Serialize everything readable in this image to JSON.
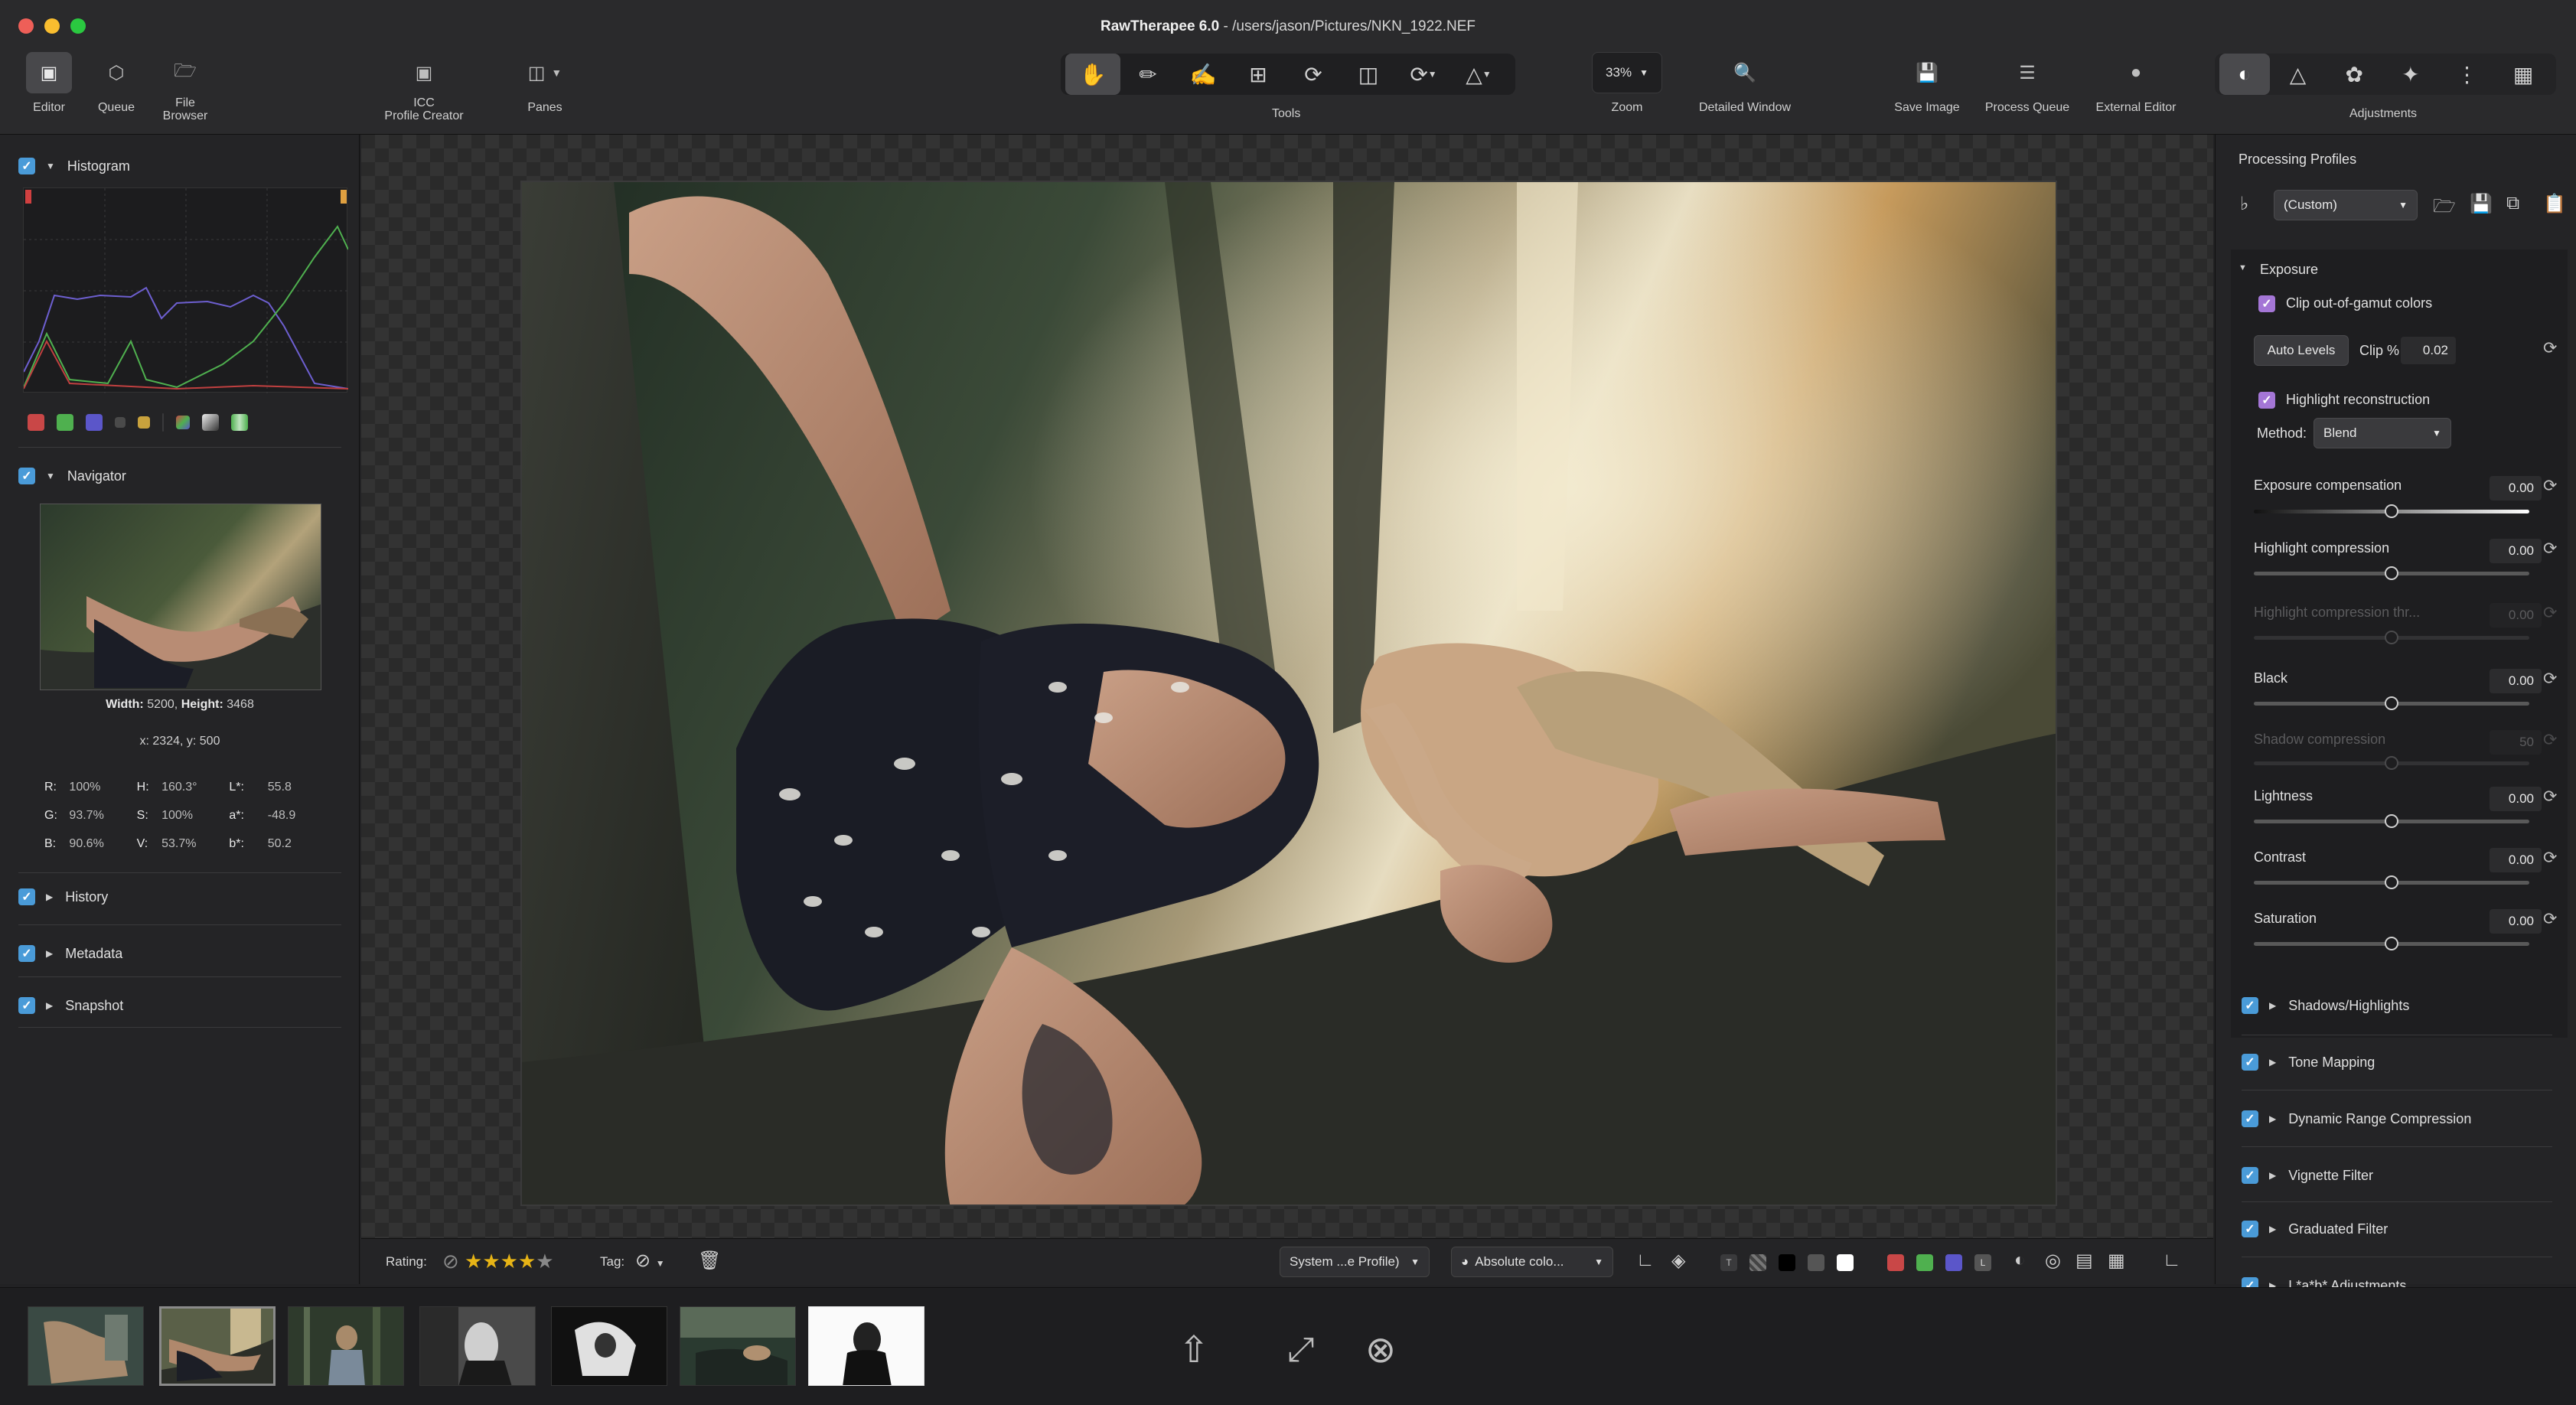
{
  "window": {
    "app_name": "RawTherapee 6.0",
    "separator": " - ",
    "file_path": "/users/jason/Pictures/NKN_1922.NEF"
  },
  "toolbar": {
    "editor": "Editor",
    "queue": "Queue",
    "file_browser_1": "File",
    "file_browser_2": "Browser",
    "icc_1": "ICC",
    "icc_2": "Profile Creator",
    "panes": "Panes",
    "tools": "Tools",
    "zoom_value": "33%",
    "zoom": "Zoom",
    "detailed_window": "Detailed Window",
    "save_image": "Save Image",
    "process_queue": "Process Queue",
    "external_editor": "External Editor",
    "adjustments": "Adjustments"
  },
  "left": {
    "histogram": "Histogram",
    "navigator": "Navigator",
    "size_width_label": "Width:",
    "size_width": "5200",
    "size_height_label": "Height:",
    "size_height": "3468",
    "coords": "x: 2324, y: 500",
    "values": [
      {
        "k1": "R:",
        "v1": "100%",
        "k2": "H:",
        "v2": "160.3°",
        "k3": "L*:",
        "v3": "55.8"
      },
      {
        "k1": "G:",
        "v1": "93.7%",
        "k2": "S:",
        "v2": "100%",
        "k3": "a*:",
        "v3": "-48.9"
      },
      {
        "k1": "B:",
        "v1": "90.6%",
        "k2": "V:",
        "v2": "53.7%",
        "k3": "b*:",
        "v3": "50.2"
      }
    ],
    "history": "History",
    "metadata": "Metadata",
    "snapshot": "Snapshot"
  },
  "bottombar": {
    "rating_label": "Rating:",
    "rating_value": 4,
    "rating_max": 5,
    "tag_label": "Tag:",
    "profile_combo": "System ...e Profile)",
    "intent_combo": "Absolute colo..."
  },
  "right": {
    "processing_profiles": "Processing Profiles",
    "profile_value": "(Custom)",
    "exposure": "Exposure",
    "clip_gamut": "Clip out-of-gamut colors",
    "auto_levels": "Auto Levels",
    "clip_label": "Clip %",
    "clip_value": "0.02",
    "highlight_recon": "Highlight reconstruction",
    "method_label": "Method:",
    "method_value": "Blend",
    "sliders": [
      {
        "label": "Exposure compensation",
        "value": "0.00"
      },
      {
        "label": "Highlight compression",
        "value": "0.00"
      },
      {
        "label": "Highlight compression thr...",
        "value": "0.00"
      },
      {
        "label": "Black",
        "value": "0.00"
      },
      {
        "label": "Shadow compression",
        "value": "50"
      },
      {
        "label": "Lightness",
        "value": "0.00"
      },
      {
        "label": "Contrast",
        "value": "0.00"
      },
      {
        "label": "Saturation",
        "value": "0.00"
      }
    ],
    "sections": [
      "Shadows/Highlights",
      "Tone Mapping",
      "Dynamic Range Compression",
      "Vignette Filter",
      "Graduated Filter",
      "L*a*b* Adjustments"
    ]
  },
  "colors": {
    "accent_blue": "#4a9bd8",
    "accent_purple": "#a476d6",
    "traffic_red": "#ee5f58",
    "traffic_yellow": "#f9bd2f",
    "traffic_green": "#2ac840"
  }
}
